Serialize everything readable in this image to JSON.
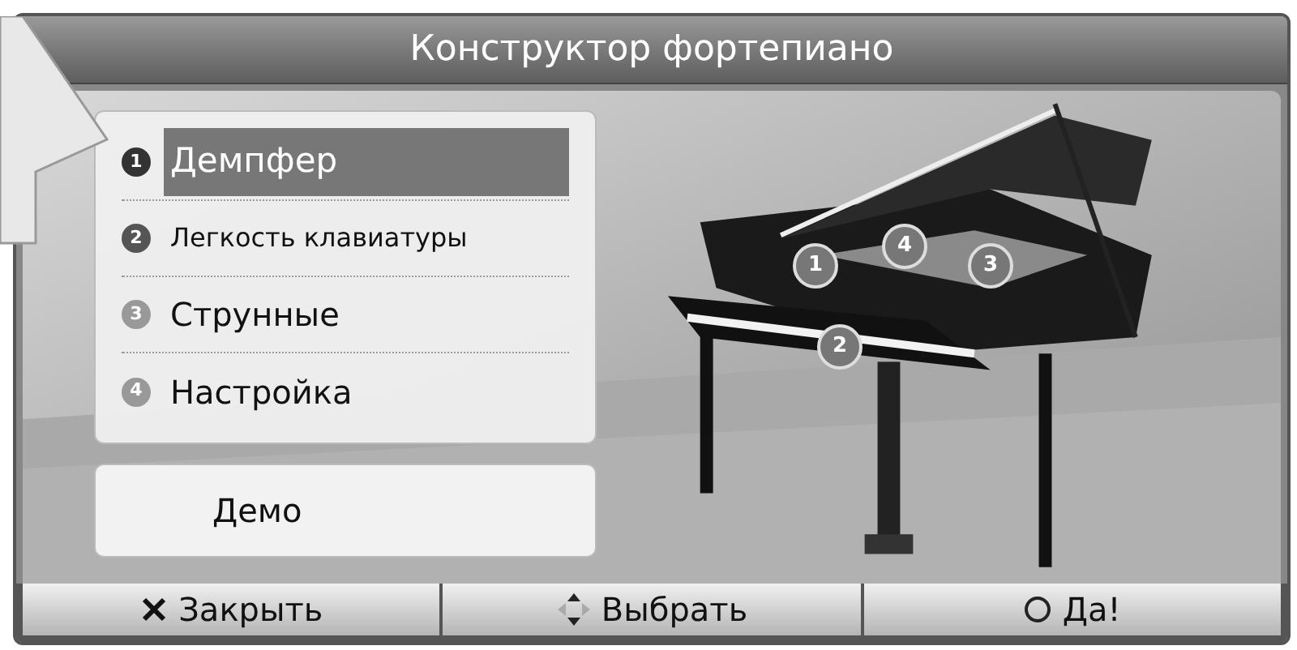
{
  "window": {
    "title": "Конструктор фортепиано"
  },
  "menu": [
    {
      "number": "1",
      "label": "Демпфер",
      "selected": true
    },
    {
      "number": "2",
      "label": "Легкость клавиатуры",
      "selected": false
    },
    {
      "number": "3",
      "label": "Струнные",
      "selected": false
    },
    {
      "number": "4",
      "label": "Настройка",
      "selected": false
    }
  ],
  "demo_button": "Демо",
  "markers": [
    {
      "number": "1"
    },
    {
      "number": "4"
    },
    {
      "number": "3"
    },
    {
      "number": "2"
    }
  ],
  "footer": [
    {
      "kind": "close",
      "label": "Закрыть"
    },
    {
      "kind": "select",
      "label": "Выбрать"
    },
    {
      "kind": "ok",
      "label": "Да!"
    }
  ]
}
